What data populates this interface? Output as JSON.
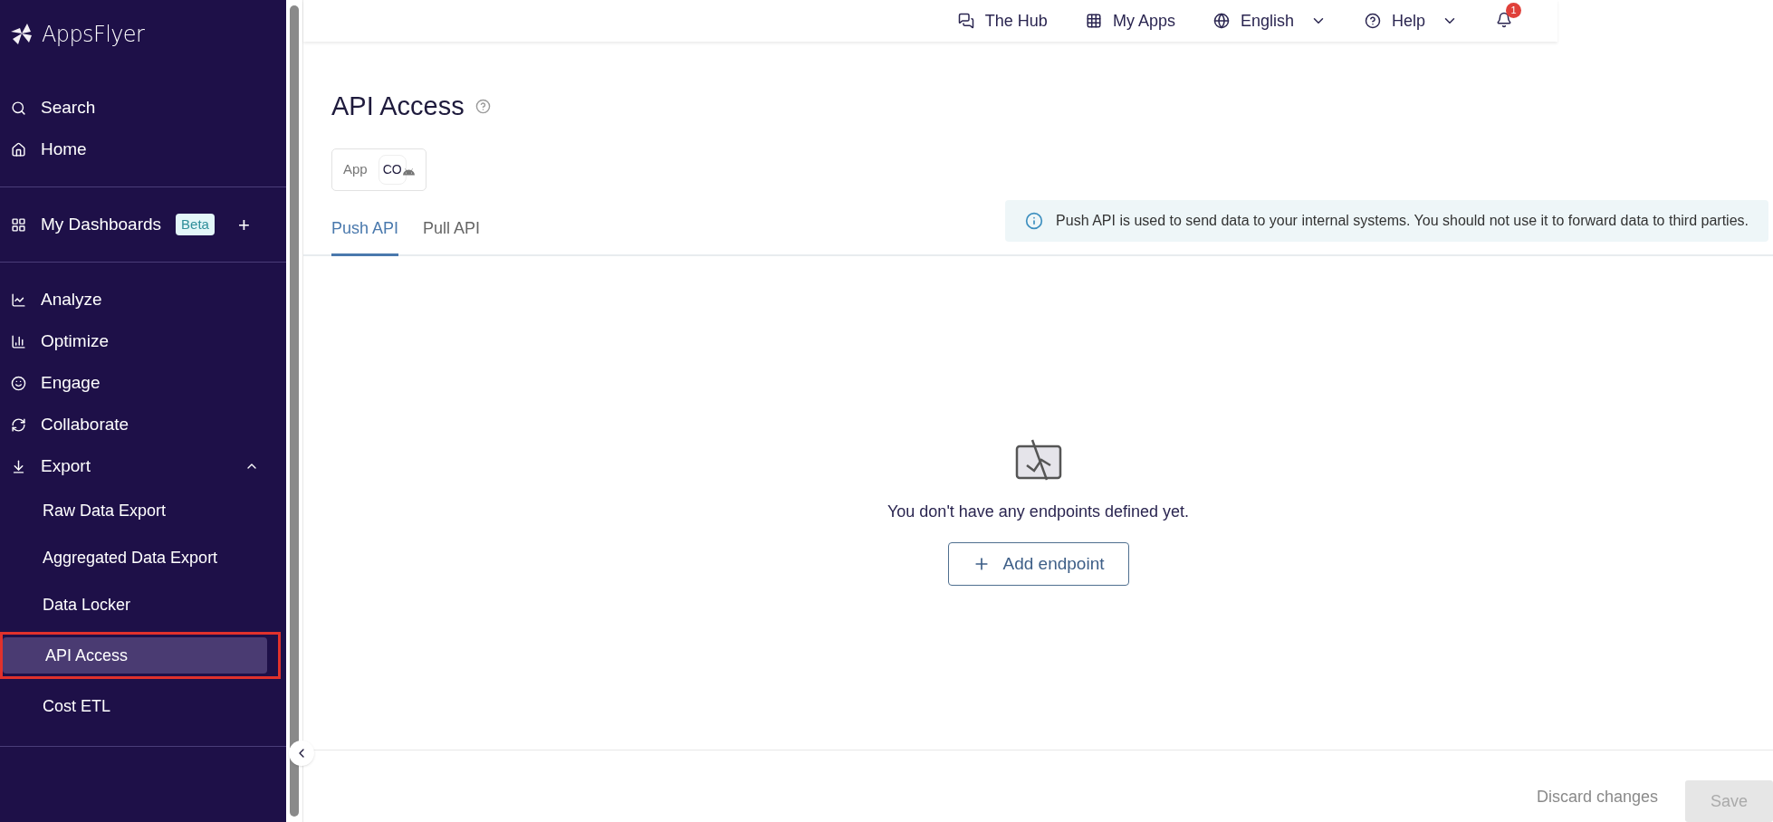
{
  "sidebar": {
    "logo": "AppsFlyer",
    "items": [
      {
        "kind": "item",
        "label": "Search"
      },
      {
        "kind": "item",
        "label": "Home"
      },
      {
        "kind": "divider"
      },
      {
        "kind": "item",
        "label": "My Dashboards",
        "badge": "Beta",
        "action": "+"
      },
      {
        "kind": "divider"
      },
      {
        "kind": "item",
        "label": "Analyze"
      },
      {
        "kind": "item",
        "label": "Optimize"
      },
      {
        "kind": "item",
        "label": "Engage"
      },
      {
        "kind": "item",
        "label": "Collaborate"
      },
      {
        "kind": "group",
        "label": "Export",
        "expanded": true,
        "children": [
          {
            "label": "Raw Data Export",
            "selected": false
          },
          {
            "label": "Aggregated Data Export",
            "selected": false
          },
          {
            "label": "Data Locker",
            "selected": false
          },
          {
            "label": "API Access",
            "selected": true,
            "highlighted": true
          },
          {
            "label": "Cost ETL",
            "selected": false
          }
        ]
      },
      {
        "kind": "divider"
      }
    ]
  },
  "topbar": {
    "items": [
      {
        "label": "The Hub",
        "dropdown": false
      },
      {
        "label": "My Apps",
        "dropdown": false
      },
      {
        "label": "English",
        "dropdown": true
      },
      {
        "label": "Help",
        "dropdown": true
      }
    ],
    "notifications": {
      "count": "1"
    }
  },
  "page": {
    "title": "API Access",
    "app_selector": {
      "label": "App",
      "value": "CO"
    },
    "tabs": [
      {
        "label": "Push API",
        "selected": true
      },
      {
        "label": "Pull API",
        "selected": false
      }
    ],
    "info": "Push API is used to send data to your internal systems. You should not use it to forward data to third parties.",
    "empty_message": "You don't have any endpoints defined yet.",
    "add_button": "Add endpoint"
  },
  "footer": {
    "discard": "Discard changes",
    "save": {
      "label": "Save",
      "disabled": true
    }
  }
}
